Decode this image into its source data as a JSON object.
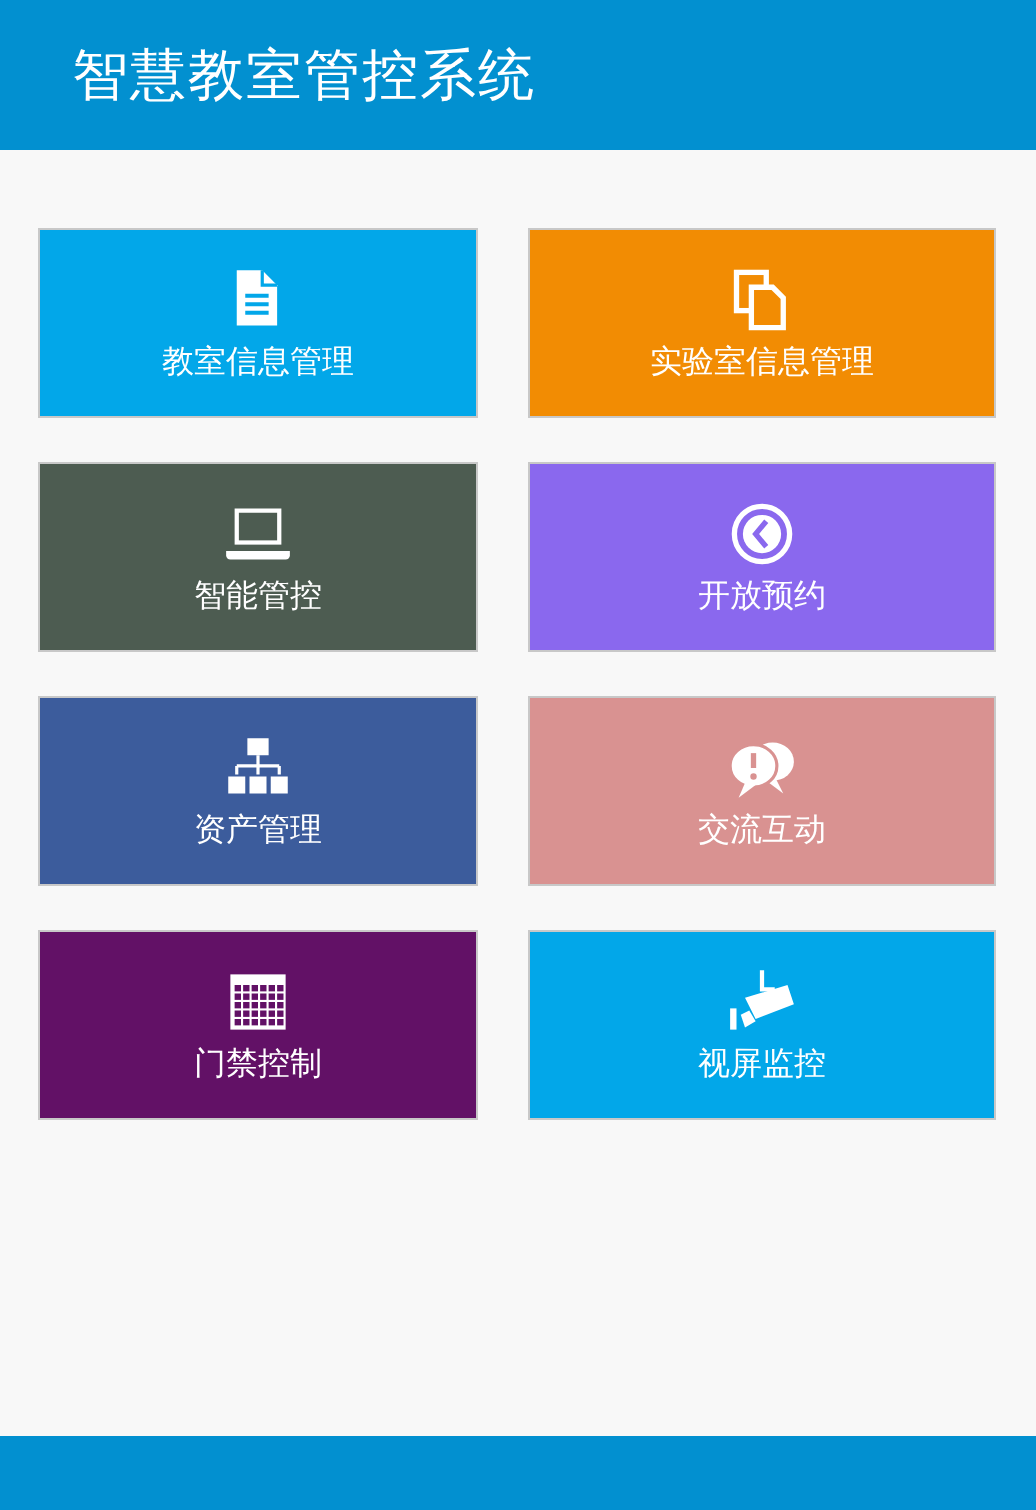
{
  "header": {
    "title": "智慧教室管控系统"
  },
  "tiles": [
    {
      "label": "教室信息管理",
      "color": "#02a7e9"
    },
    {
      "label": "实验室信息管理",
      "color": "#f28c03"
    },
    {
      "label": "智能管控",
      "color": "#4d5c51"
    },
    {
      "label": "开放预约",
      "color": "#8a68ee"
    },
    {
      "label": "资产管理",
      "color": "#3c5c9c"
    },
    {
      "label": "交流互动",
      "color": "#d99291"
    },
    {
      "label": "门禁控制",
      "color": "#621166"
    },
    {
      "label": "视屏监控",
      "color": "#02a7e9"
    }
  ]
}
